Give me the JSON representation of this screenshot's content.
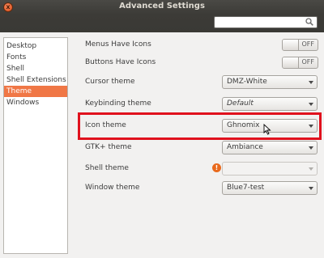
{
  "window": {
    "title": "Advanced Settings",
    "close_glyph": "x"
  },
  "search": {
    "placeholder": "",
    "icon": "search-icon"
  },
  "sidebar": {
    "items": [
      {
        "label": "Desktop"
      },
      {
        "label": "Fonts"
      },
      {
        "label": "Shell"
      },
      {
        "label": "Shell Extensions"
      },
      {
        "label": "Theme",
        "selected": true
      },
      {
        "label": "Windows"
      }
    ]
  },
  "settings": {
    "menus_have_icons": {
      "label": "Menus Have Icons",
      "state": "OFF"
    },
    "buttons_have_icons": {
      "label": "Buttons Have Icons",
      "state": "OFF"
    },
    "cursor_theme": {
      "label": "Cursor theme",
      "value": "DMZ-White"
    },
    "keybinding_theme": {
      "label": "Keybinding theme",
      "value": "Default"
    },
    "icon_theme": {
      "label": "Icon theme",
      "value": "Ghnomix"
    },
    "gtk_theme": {
      "label": "GTK+ theme",
      "value": "Ambiance"
    },
    "shell_theme": {
      "label": "Shell theme",
      "value": "",
      "warning_glyph": "!"
    },
    "window_theme": {
      "label": "Window theme",
      "value": "Blue7-test"
    }
  },
  "colors": {
    "accent": "#f07746",
    "highlight": "#e0111d",
    "titlebar": "#3c3b37"
  }
}
